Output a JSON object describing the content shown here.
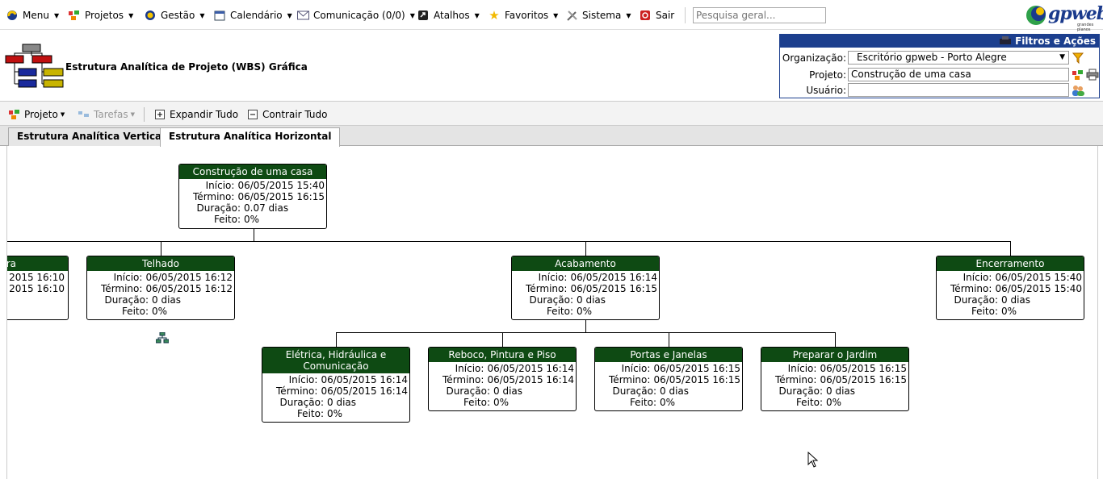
{
  "menu": {
    "items": [
      {
        "label": "Menu",
        "icon": "menu-icon"
      },
      {
        "label": "Projetos",
        "icon": "projects-icon"
      },
      {
        "label": "Gestão",
        "icon": "management-icon"
      },
      {
        "label": "Calendário",
        "icon": "calendar-icon"
      },
      {
        "label": "Comunicação (0/0)",
        "icon": "mail-icon"
      },
      {
        "label": "Atalhos",
        "icon": "shortcut-icon"
      },
      {
        "label": "Favoritos",
        "icon": "star-icon"
      },
      {
        "label": "Sistema",
        "icon": "tools-icon"
      },
      {
        "label": "Sair",
        "icon": "exit-icon"
      }
    ],
    "search_placeholder": "Pesquisa geral...",
    "logo_text": "gpweb",
    "logo_sub": "grandes planos"
  },
  "header": {
    "title": "Estrutura Analítica de Projeto (WBS) Gráfica"
  },
  "filters": {
    "title": "Filtros e Ações",
    "org_label": "Organização:",
    "org_value": "Escritório gpweb - Porto Alegre",
    "project_label": "Projeto:",
    "project_value": "Construção de uma casa",
    "user_label": "Usuário:",
    "user_value": ""
  },
  "toolbar": {
    "project": "Projeto",
    "tasks": "Tarefas",
    "expand": "Expandir Tudo",
    "collapse": "Contrair Tudo"
  },
  "tabs": {
    "vertical": "Estrutura Analítica Vertical",
    "horizontal": "Estrutura Analítica Horizontal"
  },
  "labels": {
    "start": "Início:",
    "end": "Término:",
    "duration": "Duração:",
    "done": "Feito:"
  },
  "wbs": {
    "root": {
      "title": "Construção de uma casa",
      "start": "06/05/2015 15:40",
      "end": "06/05/2015 16:15",
      "duration": "0.07 dias",
      "done": "0%"
    },
    "partial": {
      "title": "ra",
      "start": "2015 16:10",
      "end": "2015 16:10"
    },
    "telhado": {
      "title": "Telhado",
      "start": "06/05/2015 16:12",
      "end": "06/05/2015 16:12",
      "duration": "0 dias",
      "done": "0%"
    },
    "acabamento": {
      "title": "Acabamento",
      "start": "06/05/2015 16:14",
      "end": "06/05/2015 16:15",
      "duration": "0 dias",
      "done": "0%"
    },
    "encerramento": {
      "title": "Encerramento",
      "start": "06/05/2015 15:40",
      "end": "06/05/2015 15:40",
      "duration": "0 dias",
      "done": "0%"
    },
    "eletrica": {
      "title": "Elétrica, Hidráulica e Comunicação",
      "start": "06/05/2015 16:14",
      "end": "06/05/2015 16:14",
      "duration": "0 dias",
      "done": "0%"
    },
    "reboco": {
      "title": "Reboco, Pintura e Piso",
      "start": "06/05/2015 16:14",
      "end": "06/05/2015 16:14",
      "duration": "0 dias",
      "done": "0%"
    },
    "portas": {
      "title": "Portas e Janelas",
      "start": "06/05/2015 16:15",
      "end": "06/05/2015 16:15",
      "duration": "0 dias",
      "done": "0%"
    },
    "jardim": {
      "title": "Preparar o Jardim",
      "start": "06/05/2015 16:15",
      "end": "06/05/2015 16:15",
      "duration": "0 dias",
      "done": "0%"
    }
  }
}
